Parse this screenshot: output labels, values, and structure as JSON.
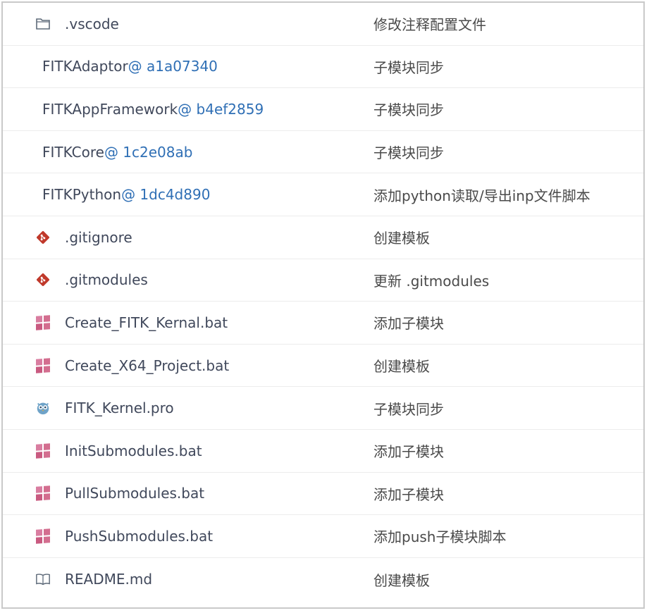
{
  "files": [
    {
      "type": "folder",
      "icon": "folder-icon",
      "name": ".vscode",
      "message": "修改注释配置文件"
    },
    {
      "type": "submodule",
      "name": "FITKAdaptor",
      "hash": "@ a1a07340",
      "message": "子模块同步"
    },
    {
      "type": "submodule",
      "name": "FITKAppFramework",
      "hash": "@ b4ef2859",
      "message": "子模块同步"
    },
    {
      "type": "submodule",
      "name": "FITKCore",
      "hash": "@ 1c2e08ab",
      "message": "子模块同步"
    },
    {
      "type": "submodule",
      "name": "FITKPython",
      "hash": "@ 1dc4d890",
      "message": "添加python读取/导出inp文件脚本"
    },
    {
      "type": "git",
      "icon": "git-icon",
      "name": ".gitignore",
      "message": "创建模板"
    },
    {
      "type": "git",
      "icon": "git-icon",
      "name": ".gitmodules",
      "message": "更新 .gitmodules"
    },
    {
      "type": "bat",
      "icon": "windows-icon",
      "name": "Create_FITK_Kernal.bat",
      "message": "添加子模块"
    },
    {
      "type": "bat",
      "icon": "windows-icon",
      "name": "Create_X64_Project.bat",
      "message": "创建模板"
    },
    {
      "type": "pro",
      "icon": "qt-owl-icon",
      "name": "FITK_Kernel.pro",
      "message": "子模块同步"
    },
    {
      "type": "bat",
      "icon": "windows-icon",
      "name": "InitSubmodules.bat",
      "message": "添加子模块"
    },
    {
      "type": "bat",
      "icon": "windows-icon",
      "name": "PullSubmodules.bat",
      "message": "添加子模块"
    },
    {
      "type": "bat",
      "icon": "windows-icon",
      "name": "PushSubmodules.bat",
      "message": "添加push子模块脚本"
    },
    {
      "type": "readme",
      "icon": "book-icon",
      "name": "README.md",
      "message": "创建模板"
    }
  ],
  "colors": {
    "link": "#2f6fb5",
    "git": "#c0392b",
    "windows": "#d36e8f",
    "text": "#40485b"
  }
}
